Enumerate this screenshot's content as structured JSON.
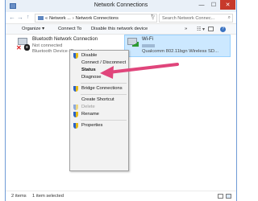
{
  "window": {
    "title": "Network Connections",
    "buttons": {
      "minimize": "—",
      "maximize": "☐",
      "close": "✕"
    }
  },
  "address": {
    "back": "←",
    "forward": "→",
    "up": "↑",
    "crumbs": [
      "«",
      "Network ...",
      "›",
      "Network Connections"
    ],
    "dropdown": "⌄",
    "refresh": "↻",
    "search_placeholder": "Search Network Connec...",
    "search_icon": "⌕"
  },
  "commands": {
    "organize": "Organize ▾",
    "connect_to": "Connect To",
    "disable_device": "Disable this network device",
    "more": "»",
    "view": "☷ ▾"
  },
  "connections": [
    {
      "name": "Bluetooth Network Connection",
      "status": "Not connected",
      "device": "Bluetooth Device (Personal Area ..."
    },
    {
      "name": "Wi-Fi",
      "status": "",
      "device": "Qualcomm 802.11bgn Wireless SD..."
    }
  ],
  "context_menu": {
    "items": [
      {
        "label": "Disable",
        "shield": true,
        "bold": false,
        "disabled": false
      },
      {
        "label": "Connect / Disconnect",
        "shield": false,
        "bold": false,
        "disabled": false
      },
      {
        "label": "Status",
        "shield": false,
        "bold": true,
        "disabled": false
      },
      {
        "label": "Diagnose",
        "shield": false,
        "bold": false,
        "disabled": false
      },
      {
        "label": "Bridge Connections",
        "shield": true,
        "bold": false,
        "disabled": false
      },
      {
        "label": "Create Shortcut",
        "shield": false,
        "bold": false,
        "disabled": false
      },
      {
        "label": "Delete",
        "shield": true,
        "bold": false,
        "disabled": true
      },
      {
        "label": "Rename",
        "shield": true,
        "bold": false,
        "disabled": false
      },
      {
        "label": "Properties",
        "shield": true,
        "bold": false,
        "disabled": false
      }
    ]
  },
  "statusbar": {
    "item_count": "2 items",
    "selected": "1 item selected"
  },
  "colors": {
    "accent_blue": "#3b73c2",
    "selection": "#cce8ff",
    "arrow": "#e0457b",
    "close": "#c7392b"
  }
}
